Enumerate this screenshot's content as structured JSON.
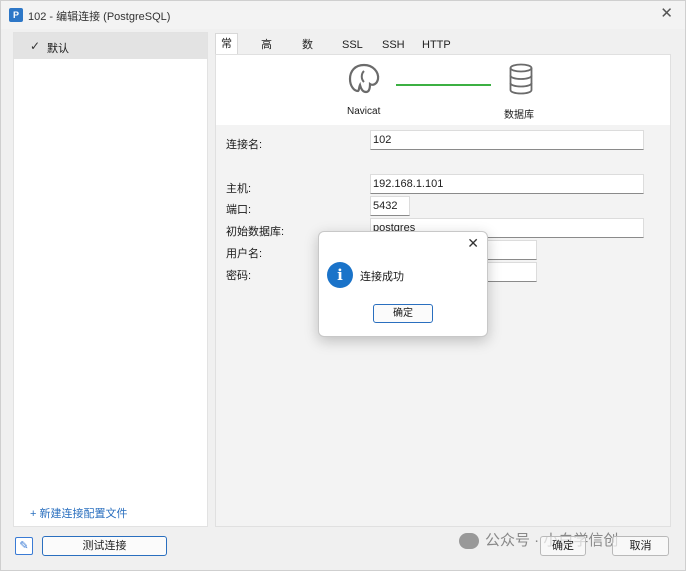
{
  "window": {
    "title": "102 - 编辑连接 (PostgreSQL)",
    "close_glyph": "✕",
    "app_icon": "elephant-icon"
  },
  "sidebar": {
    "items": [
      {
        "label": "默认",
        "selected": true,
        "check_glyph": "✓"
      }
    ],
    "new_profile_label": "+ 新建连接配置文件"
  },
  "tabs": [
    {
      "label": "常规",
      "active": true
    },
    {
      "label": "高级",
      "active": false
    },
    {
      "label": "数据库",
      "active": false
    },
    {
      "label": "SSL",
      "active": false
    },
    {
      "label": "SSH",
      "active": false
    },
    {
      "label": "HTTP",
      "active": false
    }
  ],
  "diagram": {
    "left_label": "Navicat",
    "right_label": "数据库",
    "line_color": "#3cb043"
  },
  "form": {
    "connection_name": {
      "label": "连接名:",
      "value": "102"
    },
    "host": {
      "label": "主机:",
      "value": "192.168.1.101"
    },
    "port": {
      "label": "端口:",
      "value": "5432"
    },
    "initial_db": {
      "label": "初始数据库:",
      "value": "postgres"
    },
    "username": {
      "label": "用户名:",
      "value": ""
    },
    "password": {
      "label": "密码:",
      "value": ""
    }
  },
  "footer": {
    "test_button": "测试连接",
    "ok_button": "确定",
    "cancel_button": "取消"
  },
  "watermark": "公众号 · 小白学信创",
  "dialog": {
    "message": "连接成功",
    "ok_button": "确定",
    "close_glyph": "✕",
    "icon": "info-icon",
    "icon_glyph": "i"
  },
  "colors": {
    "accent": "#2a6fbf",
    "info": "#1a73c9",
    "link": "#2a6fbf"
  }
}
